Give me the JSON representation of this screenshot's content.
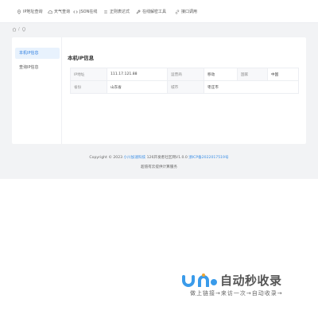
{
  "nav": {
    "items": [
      {
        "icon": "pin-icon",
        "label": "IP地址查询"
      },
      {
        "icon": "cloud-icon",
        "label": "天气查询"
      },
      {
        "icon": "code-icon",
        "label": "JSON在线"
      },
      {
        "icon": "list-icon",
        "label": "正则表达式"
      },
      {
        "icon": "wrench-icon",
        "label": "在线解密工具"
      },
      {
        "icon": "link-icon",
        "label": "接口调用"
      }
    ]
  },
  "breadcrumb": {
    "sep": "/"
  },
  "sidebar": {
    "items": [
      {
        "label": "本机IP信息",
        "active": true
      },
      {
        "label": "查询IP信息",
        "active": false
      }
    ]
  },
  "main": {
    "title": "本机IP信息",
    "rows": [
      [
        {
          "key": "IP地址",
          "value": "111.17.121.88"
        },
        {
          "key": "运营商",
          "value": "移动"
        },
        {
          "key": "国家",
          "value": "中国"
        }
      ],
      [
        {
          "key": "省份",
          "value": "山东省"
        },
        {
          "key": "城市",
          "value": "枣庄市"
        }
      ]
    ]
  },
  "footer": {
    "copyright_prefix": "Copyright © 2023",
    "site_name": "小川加速科技",
    "copyright_mid": "126开发者社区网V1.0.0",
    "icp": "浙ICP备2022017519号",
    "host": "超值有云提供计算服务"
  },
  "watermark": {
    "title": "自动秒收录",
    "slogan": "做上链接→来访一次→自动收录→"
  },
  "colors": {
    "accent": "#2f7fe0",
    "active_bg": "#e8f2fd",
    "page_bg": "#f2f3f5",
    "watermark_blue": "#3a9bea"
  }
}
